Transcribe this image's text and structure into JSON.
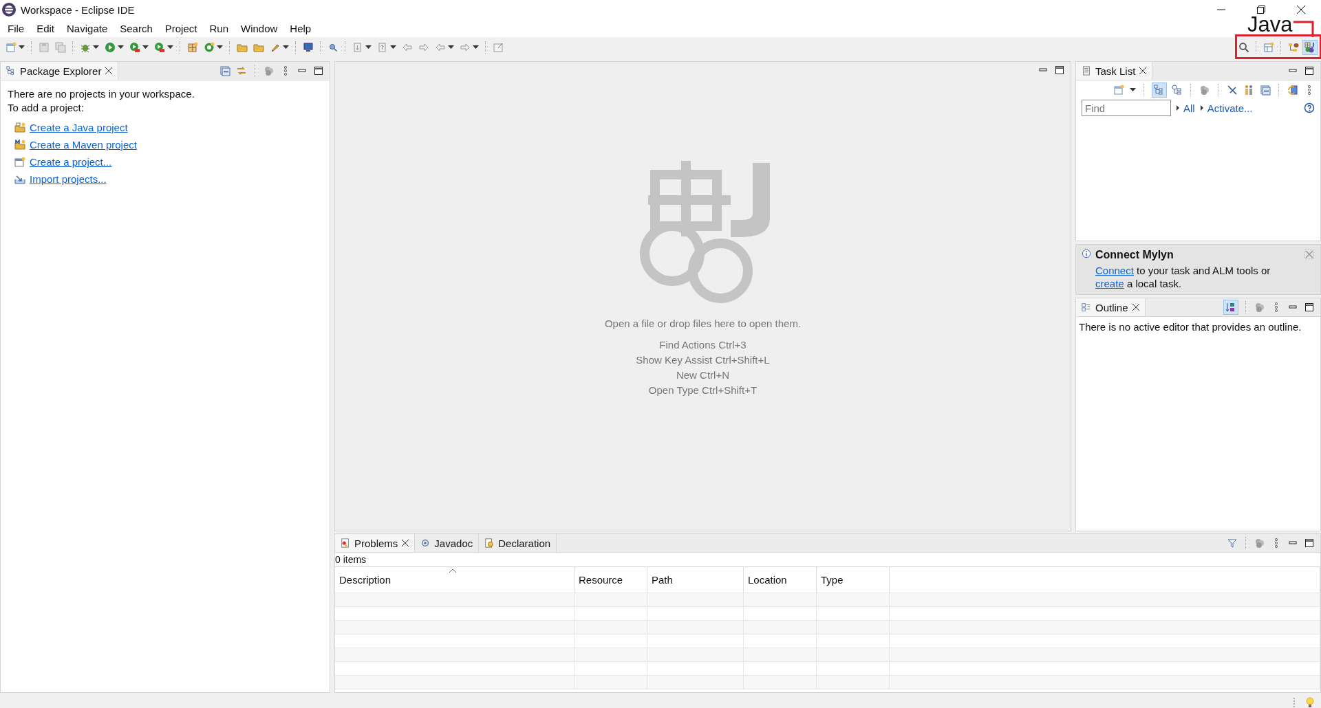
{
  "window": {
    "title": "Workspace - Eclipse IDE"
  },
  "menu": [
    "File",
    "Edit",
    "Navigate",
    "Search",
    "Project",
    "Run",
    "Window",
    "Help"
  ],
  "annotation": {
    "label": "Java"
  },
  "package_explorer": {
    "tab": "Package Explorer",
    "message": [
      "There are no projects in your workspace.",
      "To add a project:"
    ],
    "links": [
      {
        "kind": "java",
        "label": "Create a Java project"
      },
      {
        "kind": "maven",
        "label": "Create a Maven project"
      },
      {
        "kind": "project",
        "label": "Create a project..."
      },
      {
        "kind": "import",
        "label": "Import projects..."
      }
    ]
  },
  "editor": {
    "hint": "Open a file or drop files here to open them.",
    "shortcuts": [
      "Find Actions Ctrl+3",
      "Show Key Assist Ctrl+Shift+L",
      "New Ctrl+N",
      "Open Type Ctrl+Shift+T"
    ]
  },
  "task_list": {
    "tab": "Task List",
    "find": {
      "placeholder": "Find"
    },
    "filters": [
      "All",
      "Activate..."
    ]
  },
  "mylyn": {
    "title": "Connect Mylyn",
    "message": [
      {
        "text": "Connect",
        "link": true
      },
      {
        "text": "to your task and ALM tools or",
        "link": false
      },
      {
        "text": "create",
        "link": true
      },
      {
        "text": "a local task.",
        "link": false
      }
    ]
  },
  "outline": {
    "tab": "Outline",
    "message": "There is no active editor that provides an outline."
  },
  "bottom": {
    "tabs": [
      {
        "label": "Problems",
        "kind": "problems",
        "selected": true
      },
      {
        "label": "Javadoc",
        "kind": "javadoc",
        "selected": false
      },
      {
        "label": "Declaration",
        "kind": "declaration",
        "selected": false
      }
    ],
    "count": "0 items",
    "columns": [
      "Description",
      "Resource",
      "Path",
      "Location",
      "Type"
    ]
  }
}
